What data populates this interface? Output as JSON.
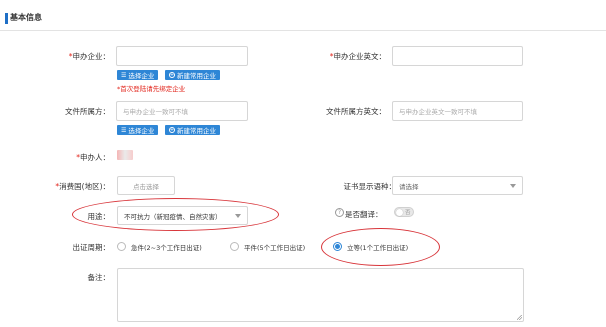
{
  "section": {
    "title": "基本信息"
  },
  "applicant_company": {
    "required_mark": "*",
    "label": "申办企业：",
    "value": "",
    "select_btn": "选择企业",
    "create_btn": "新建常用企业",
    "hint": "*首次登陆请先绑定企业"
  },
  "applicant_company_en": {
    "required_mark": "*",
    "label": "申办企业英文：",
    "value": ""
  },
  "doc_owner": {
    "label": "文件所属方：",
    "placeholder": "与申办企业一致可不填",
    "select_btn": "选择企业",
    "create_btn": "新建常用企业"
  },
  "doc_owner_en": {
    "label": "文件所属方英文：",
    "placeholder": "与申办企业英文一致可不填"
  },
  "applicant_person": {
    "required_mark": "*",
    "label": "申办人："
  },
  "destination": {
    "required_mark": "*",
    "label": "消费国(地区)：",
    "button": "点击选择"
  },
  "cert_language": {
    "label": "证书显示语种：",
    "value": "请选择"
  },
  "purpose": {
    "label": "用途：",
    "value": "不可抗力（新冠疫情、自然灾害）"
  },
  "translate": {
    "help_glyph": "?",
    "label": "是否翻译：",
    "toggle_text": "否",
    "state": "off"
  },
  "issue_period": {
    "label": "出证周期：",
    "options": [
      {
        "label": "急件(2~3个工作日出证)",
        "selected": false
      },
      {
        "label": "平件(5个工作日出证)",
        "selected": false
      },
      {
        "label": "立等(1个工作日出证)",
        "selected": true
      }
    ]
  },
  "remarks": {
    "label": "备注：",
    "value": ""
  },
  "colors": {
    "accent": "#2e86d6",
    "required": "#e2231a",
    "annotation": "#d8353a",
    "section_bar": "#1f6fc6"
  }
}
